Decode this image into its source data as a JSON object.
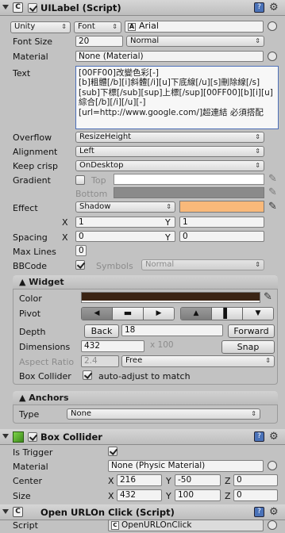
{
  "uilabel": {
    "title": "UILabel (Script)",
    "font_type": "Unity",
    "font_kind": "Font",
    "font_name": "Arial",
    "font_size_label": "Font Size",
    "font_size": "20",
    "font_style": "Normal",
    "material_label": "Material",
    "material": "None (Material)",
    "text_label": "Text",
    "text_lines": [
      "[00FF00]改變色彩[-]",
      "[b]粗體[/b][i]斜體[/i][u]下底線[/u][s]刪除線[/s]",
      "[sub]下標[/sub][sup]上標[/sup][00FF00][b][i][u]綜合[/b][/i][/u][-]",
      "[url=http://www.google.com/]超連結 必須搭配"
    ],
    "overflow_label": "Overflow",
    "overflow": "ResizeHeight",
    "alignment_label": "Alignment",
    "alignment": "Left",
    "keepcrisp_label": "Keep crisp",
    "keepcrisp": "OnDesktop",
    "gradient_label": "Gradient",
    "gradient_top": "Top",
    "gradient_bottom": "Bottom",
    "effect_label": "Effect",
    "effect": "Shadow",
    "effect_color": "#f9b97a",
    "effect_x_label": "X",
    "effect_x": "1",
    "effect_y_label": "Y",
    "effect_y": "1",
    "spacing_label": "Spacing",
    "spacing_x_label": "X",
    "spacing_x": "0",
    "spacing_y_label": "Y",
    "spacing_y": "0",
    "maxlines_label": "Max Lines",
    "maxlines": "0",
    "bbcode_label": "BBCode",
    "symbols_label": "Symbols",
    "symbols": "Normal"
  },
  "widget": {
    "title": "▲ Widget",
    "color_label": "Color",
    "color": "#3b2414",
    "pivot_label": "Pivot",
    "depth_label": "Depth",
    "back_label": "Back",
    "depth": "18",
    "forward_label": "Forward",
    "dimensions_label": "Dimensions",
    "dim_w": "432",
    "dim_h": "x 100",
    "snap_label": "Snap",
    "aspect_label": "Aspect Ratio",
    "aspect": "2.4",
    "aspect_mode": "Free",
    "boxcollider_label": "Box Collider",
    "autoadjust_label": "auto-adjust to match"
  },
  "anchors": {
    "title": "▲ Anchors",
    "type_label": "Type",
    "type": "None"
  },
  "boxcollider": {
    "title": "Box Collider",
    "istrigger_label": "Is Trigger",
    "material_label": "Material",
    "material": "None (Physic Material)",
    "center_label": "Center",
    "center_x_label": "X",
    "center_x": "216",
    "center_y_label": "Y",
    "center_y": "-50",
    "center_z_label": "Z",
    "center_z": "0",
    "size_label": "Size",
    "size_x_label": "X",
    "size_x": "432",
    "size_y_label": "Y",
    "size_y": "100",
    "size_z_label": "Z",
    "size_z": "0"
  },
  "openurl": {
    "title": "Open URLOn Click (Script)",
    "script_label": "Script",
    "script": "OpenURLOnClick"
  }
}
